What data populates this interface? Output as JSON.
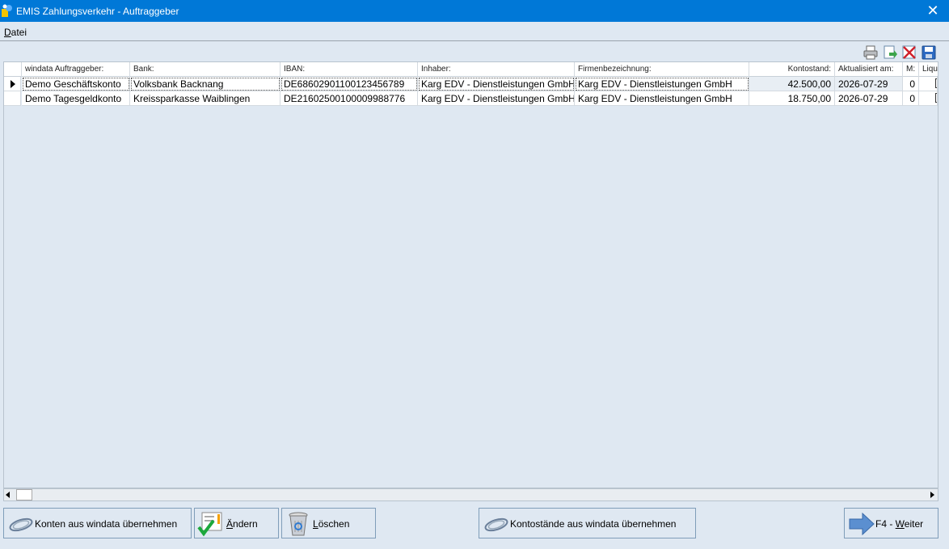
{
  "window": {
    "title": "EMIS Zahlungsverkehr - Auftraggeber",
    "close_glyph": "✕"
  },
  "menu": {
    "items": [
      {
        "label": "Datei"
      }
    ]
  },
  "toolbar": {
    "icons": [
      "printer-icon",
      "export-icon",
      "delete-icon",
      "save-icon"
    ]
  },
  "table": {
    "columns": [
      {
        "label": "windata Auftraggeber:"
      },
      {
        "label": "Bank:"
      },
      {
        "label": "IBAN:"
      },
      {
        "label": "Inhaber:"
      },
      {
        "label": "Firmenbezeichnung:"
      },
      {
        "label": "Kontostand:"
      },
      {
        "label": "Aktualisiert am:"
      },
      {
        "label": "M:"
      },
      {
        "label": "Liqu"
      }
    ],
    "rows": [
      {
        "auftraggeber": "Demo Geschäftskonto",
        "bank": "Volksbank Backnang",
        "iban": "DE68602901100123456789",
        "inhaber": "Karg EDV - Dienstleistungen GmbH",
        "firma": "Karg EDV - Dienstleistungen GmbH",
        "kontostand": "42.500,00",
        "aktualisiert": "2026-07-29",
        "m": "0",
        "selected": true
      },
      {
        "auftraggeber": "Demo Tagesgeldkonto",
        "bank": "Kreissparkasse Waiblingen",
        "iban": "DE21602500100009988776",
        "inhaber": "Karg EDV - Dienstleistungen GmbH",
        "firma": "Karg EDV - Dienstleistungen GmbH",
        "kontostand": "18.750,00",
        "aktualisiert": "2026-07-29",
        "m": "0",
        "selected": false
      }
    ]
  },
  "buttons": {
    "konten": "Konten aus windata übernehmen",
    "aendern": {
      "accel": "Ä",
      "rest": "ndern"
    },
    "loeschen": {
      "accel": "L",
      "rest": "öschen"
    },
    "kontostaende": "Kontostände aus windata übernehmen",
    "weiter": {
      "prefix": "F4 - ",
      "accel": "W",
      "rest": "eiter"
    }
  }
}
